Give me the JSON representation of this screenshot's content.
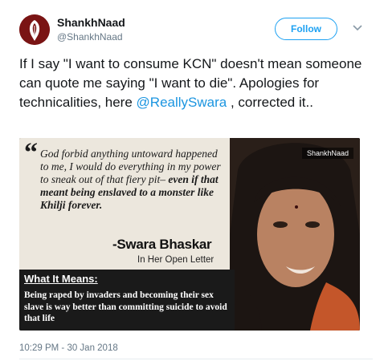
{
  "user": {
    "display_name": "ShankhNaad",
    "handle": "@ShankhNaad",
    "avatar_icon": "conch-shell-icon",
    "avatar_color": "#7a1414"
  },
  "actions": {
    "follow_label": "Follow",
    "more_icon": "chevron-down-icon"
  },
  "tweet": {
    "text_before_mention": "If I say \"I want to consume KCN\" doesn't mean someone can quote me saying \"I want to die\". Apologies for technicalities, here ",
    "mention": "@ReallySwara",
    "text_after_mention": " , corrected it..",
    "timestamp": "10:29 PM - 30 Jan 2018"
  },
  "media": {
    "watermark": "ShankhNaad",
    "quote_mark": "“",
    "quote_line_1": "God forbid anything untoward happened to me, I would do everything in my power to sneak out of that fiery pit– ",
    "quote_line_bold": "even if that meant being enslaved to a monster like Khilji forever.",
    "author": "-Swara Bhaskar",
    "author_sub": "In Her Open Letter",
    "meaning_title": "What It Means:",
    "meaning_body": "Being raped by invaders and becoming their sex slave is way better than committing suicide to avoid that life"
  },
  "colors": {
    "link": "#1b95e0",
    "follow_border": "#1da1f2",
    "muted": "#657786"
  }
}
